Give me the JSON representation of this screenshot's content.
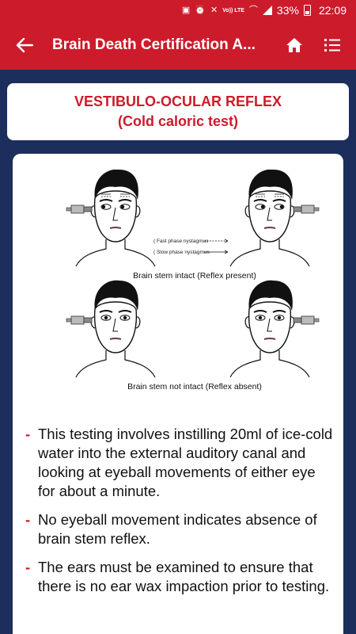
{
  "status_bar": {
    "network": "Vo)) LTE",
    "battery_percent": "33%",
    "time": "22:09"
  },
  "app_bar": {
    "title": "Brain Death Certification A...",
    "back_icon": "arrow-left-icon",
    "home_icon": "home-icon",
    "menu_icon": "list-menu-icon"
  },
  "title_card": {
    "line1": "VESTIBULO-OCULAR REFLEX",
    "line2": "(Cold caloric test)"
  },
  "illustration": {
    "legend_fast": "( Fast phase nystagmus",
    "legend_slow": "( Slow phase nystagmus",
    "caption_top": "Brain stem intact (Reflex present)",
    "caption_bottom": "Brain stem not intact (Reflex absent)"
  },
  "bullets": [
    "This testing involves instilling 20ml of ice-cold water into the external auditory canal and looking at eyeball movements of either eye for about a minute.",
    "No eyeball movement indicates absence of brain stem reflex.",
    "The ears must be examined to ensure that there is no ear wax impaction prior to testing."
  ],
  "colors": {
    "primary_red": "#cc1b2b",
    "navy_background": "#1c2e5c"
  }
}
